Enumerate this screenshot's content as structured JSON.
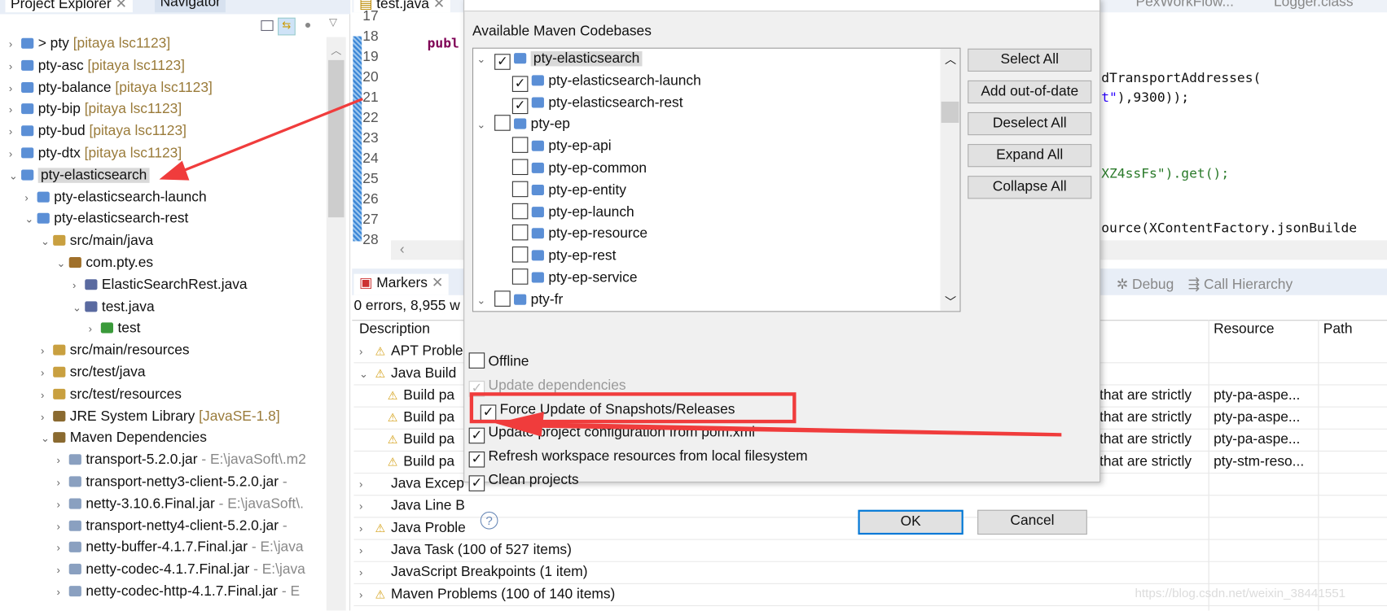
{
  "explorer": {
    "tabs": [
      "Project Explorer",
      "Navigator"
    ],
    "items": [
      {
        "t": ">",
        "ind": 0,
        "label": "> pty",
        "dec": " [pitaya lsc1123]",
        "icon": "maven-project-icon"
      },
      {
        "t": ">",
        "ind": 0,
        "label": "pty-asc",
        "dec": " [pitaya lsc1123]",
        "icon": "maven-project-icon"
      },
      {
        "t": ">",
        "ind": 0,
        "label": "pty-balance",
        "dec": " [pitaya lsc1123]",
        "icon": "maven-project-icon"
      },
      {
        "t": ">",
        "ind": 0,
        "label": "pty-bip",
        "dec": " [pitaya lsc1123]",
        "icon": "maven-project-icon"
      },
      {
        "t": ">",
        "ind": 0,
        "label": "pty-bud",
        "dec": " [pitaya lsc1123]",
        "icon": "maven-project-icon"
      },
      {
        "t": ">",
        "ind": 0,
        "label": "pty-dtx",
        "dec": " [pitaya lsc1123]",
        "icon": "maven-project-icon"
      },
      {
        "t": "v",
        "ind": 0,
        "label": "pty-elasticsearch",
        "dec": "",
        "icon": "maven-project-icon",
        "sel": true
      },
      {
        "t": ">",
        "ind": 1,
        "label": "pty-elasticsearch-launch",
        "dec": "",
        "icon": "maven-project-icon"
      },
      {
        "t": "v",
        "ind": 1,
        "label": "pty-elasticsearch-rest",
        "dec": "",
        "icon": "maven-project-icon"
      },
      {
        "t": "v",
        "ind": 2,
        "label": "src/main/java",
        "dec": "",
        "icon": "source-folder-icon"
      },
      {
        "t": "v",
        "ind": 3,
        "label": "com.pty.es",
        "dec": "",
        "icon": "package-icon"
      },
      {
        "t": ">",
        "ind": 4,
        "label": "ElasticSearchRest.java",
        "dec": "",
        "icon": "java-file-icon"
      },
      {
        "t": "v",
        "ind": 4,
        "label": "test.java",
        "dec": "",
        "icon": "java-file-icon"
      },
      {
        "t": ">",
        "ind": 5,
        "label": "test",
        "dec": "",
        "icon": "class-icon"
      },
      {
        "t": ">",
        "ind": 2,
        "label": "src/main/resources",
        "dec": "",
        "icon": "source-folder-icon"
      },
      {
        "t": ">",
        "ind": 2,
        "label": "src/test/java",
        "dec": "",
        "icon": "source-folder-icon"
      },
      {
        "t": ">",
        "ind": 2,
        "label": "src/test/resources",
        "dec": "",
        "icon": "source-folder-icon"
      },
      {
        "t": ">",
        "ind": 2,
        "label": "JRE System Library",
        "dec": " [JavaSE-1.8]",
        "icon": "library-icon"
      },
      {
        "t": "v",
        "ind": 2,
        "label": "Maven Dependencies",
        "dec": "",
        "icon": "library-icon"
      },
      {
        "t": ">",
        "ind": 3,
        "label": "transport-5.2.0.jar",
        "dec": " - E:\\javaSoft\\.m2",
        "icon": "jar-icon",
        "g": true
      },
      {
        "t": ">",
        "ind": 3,
        "label": "transport-netty3-client-5.2.0.jar",
        "dec": " - ",
        "icon": "jar-icon",
        "g": true
      },
      {
        "t": ">",
        "ind": 3,
        "label": "netty-3.10.6.Final.jar",
        "dec": " - E:\\javaSoft\\.",
        "icon": "jar-icon",
        "g": true
      },
      {
        "t": ">",
        "ind": 3,
        "label": "transport-netty4-client-5.2.0.jar",
        "dec": " - ",
        "icon": "jar-icon",
        "g": true
      },
      {
        "t": ">",
        "ind": 3,
        "label": "netty-buffer-4.1.7.Final.jar",
        "dec": " - E:\\java",
        "icon": "jar-icon",
        "g": true
      },
      {
        "t": ">",
        "ind": 3,
        "label": "netty-codec-4.1.7.Final.jar",
        "dec": " - E:\\java",
        "icon": "jar-icon",
        "g": true
      },
      {
        "t": ">",
        "ind": 3,
        "label": "netty-codec-http-4.1.7.Final.jar",
        "dec": " - E",
        "icon": "jar-icon",
        "g": true
      }
    ]
  },
  "editor": {
    "tabs": [
      "test.java",
      "PexWorkFlow...",
      "Logger.class"
    ],
    "lines": [
      "17",
      "18",
      "19",
      "20",
      "21",
      "22",
      "23",
      "24",
      "25",
      "26",
      "27",
      "28"
    ],
    "code": [
      {
        "l": "18",
        "t": "publ",
        "c": "#7f0055"
      },
      {
        "l": "20",
        "t": "dTransportAddresses(",
        "c": "#000"
      },
      {
        "l": "21a",
        "t": "t\"",
        "c": "#2a00ff"
      },
      {
        "l": "21b",
        "t": "),9300));",
        "c": "#000"
      },
      {
        "l": "25a",
        "t": "XZ4ssFs\").get();",
        "c": "#2a7a2a"
      },
      {
        "l": "28",
        "t": "ource(XContentFactory.jsonBuilde",
        "c": "#000"
      }
    ]
  },
  "markers": {
    "tabs": [
      "Markers",
      "Debug",
      "Call Hierarchy"
    ],
    "tab_partial": "n",
    "summary": "0 errors, 8,955 w",
    "columns": [
      "Description",
      "Resource",
      "Path"
    ],
    "rows": [
      {
        "t": ">",
        "w": true,
        "d": "APT Proble",
        "r": "",
        "ind": 0
      },
      {
        "t": "v",
        "w": true,
        "d": "Java Build",
        "r": "",
        "ind": 0
      },
      {
        "t": "",
        "w": true,
        "d": "Build pa",
        "tail": "that are strictly",
        "r": "pty-pa-aspe...",
        "ind": 1
      },
      {
        "t": "",
        "w": true,
        "d": "Build pa",
        "tail": "that are strictly",
        "r": "pty-pa-aspe...",
        "ind": 1
      },
      {
        "t": "",
        "w": true,
        "d": "Build pa",
        "tail": "that are strictly",
        "r": "pty-pa-aspe...",
        "ind": 1
      },
      {
        "t": "",
        "w": true,
        "d": "Build pa",
        "tail": "that are strictly",
        "r": "pty-stm-reso...",
        "ind": 1
      },
      {
        "t": ">",
        "w": false,
        "d": "Java Excep",
        "r": "",
        "ind": 0
      },
      {
        "t": ">",
        "w": false,
        "d": "Java Line B",
        "r": "",
        "ind": 0
      },
      {
        "t": ">",
        "w": true,
        "d": "Java Proble",
        "r": "",
        "ind": 0
      },
      {
        "t": ">",
        "w": false,
        "d": "Java Task (100 of 527 items)",
        "r": "",
        "ind": 0
      },
      {
        "t": ">",
        "w": false,
        "d": "JavaScript Breakpoints (1 item)",
        "r": "",
        "ind": 0
      },
      {
        "t": ">",
        "w": true,
        "d": "Maven Problems (100 of 140 items)",
        "r": "",
        "ind": 0
      }
    ]
  },
  "dialog": {
    "heading": "Available Maven Codebases",
    "codebases": [
      {
        "t": "v",
        "ind": 0,
        "label": "pty-elasticsearch",
        "checked": true,
        "sel": true
      },
      {
        "t": "",
        "ind": 1,
        "label": "pty-elasticsearch-launch",
        "checked": true
      },
      {
        "t": "",
        "ind": 1,
        "label": "pty-elasticsearch-rest",
        "checked": true
      },
      {
        "t": "v",
        "ind": 0,
        "label": "pty-ep",
        "checked": false
      },
      {
        "t": "",
        "ind": 1,
        "label": "pty-ep-api",
        "checked": false
      },
      {
        "t": "",
        "ind": 1,
        "label": "pty-ep-common",
        "checked": false
      },
      {
        "t": "",
        "ind": 1,
        "label": "pty-ep-entity",
        "checked": false
      },
      {
        "t": "",
        "ind": 1,
        "label": "pty-ep-launch",
        "checked": false
      },
      {
        "t": "",
        "ind": 1,
        "label": "pty-ep-resource",
        "checked": false
      },
      {
        "t": "",
        "ind": 1,
        "label": "pty-ep-rest",
        "checked": false
      },
      {
        "t": "",
        "ind": 1,
        "label": "pty-ep-service",
        "checked": false
      },
      {
        "t": "v",
        "ind": 0,
        "label": "pty-fr",
        "checked": false
      }
    ],
    "side_buttons": [
      "Select All",
      "Add out-of-date",
      "Deselect All",
      "Expand All",
      "Collapse All"
    ],
    "options": [
      {
        "label": "Offline",
        "checked": false,
        "disabled": false
      },
      {
        "label": "Update dependencies",
        "checked": true,
        "disabled": true
      },
      {
        "label": "Force Update of Snapshots/Releases",
        "checked": true,
        "disabled": false,
        "highlighted": true
      },
      {
        "label": "Update project configuration from pom.xml",
        "checked": true,
        "disabled": false
      },
      {
        "label": "Refresh workspace resources from local filesystem",
        "checked": true,
        "disabled": false
      },
      {
        "label": "Clean projects",
        "checked": true,
        "disabled": false
      }
    ],
    "ok": "OK",
    "cancel": "Cancel",
    "help_icon": "help-icon"
  },
  "annotation_color": "#f03c3c",
  "watermark": "https://blog.csdn.net/weixin_38441551"
}
